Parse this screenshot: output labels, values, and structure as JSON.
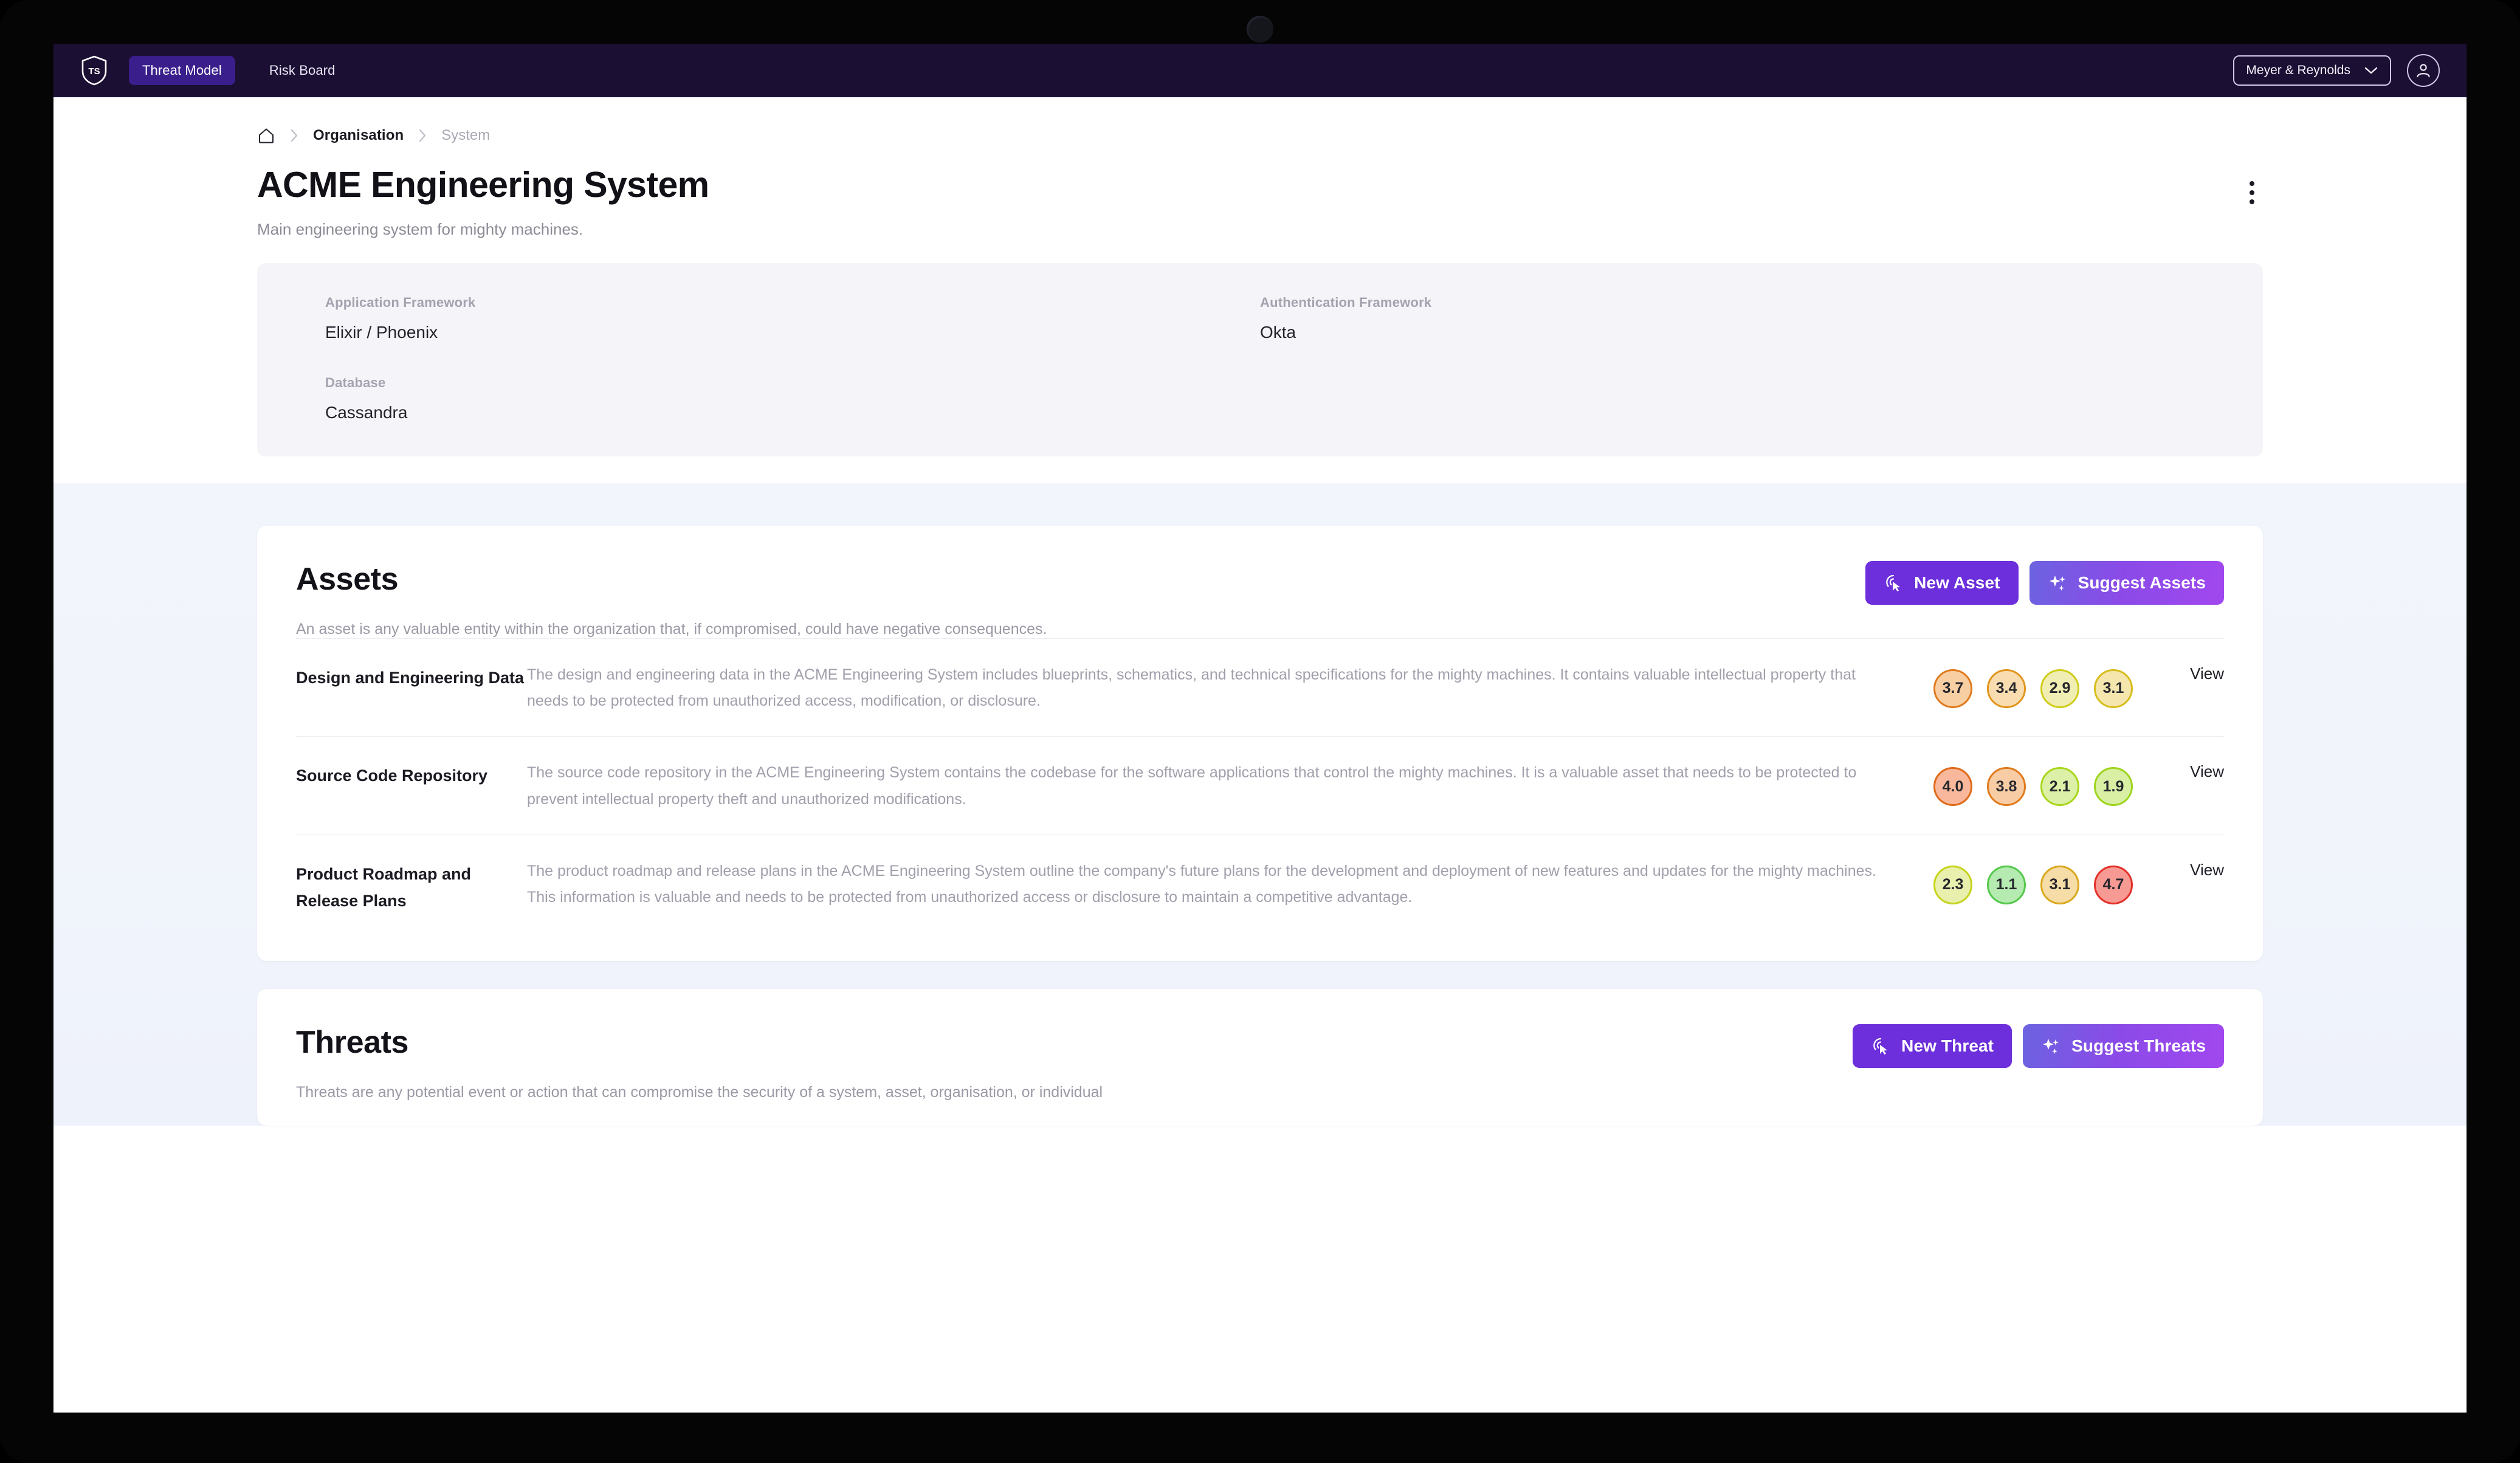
{
  "navbar": {
    "logo_text": "TS",
    "logo_icon": "shield-icon",
    "tabs": [
      {
        "label": "Threat Model",
        "active": true
      },
      {
        "label": "Risk Board",
        "active": false
      }
    ],
    "org_switcher": {
      "label": "Meyer & Reynolds",
      "icon": "chevron-down-icon"
    },
    "avatar_icon": "user-avatar-icon",
    "background_color": "#1b0f33",
    "active_tab_color": "#3a1f8c"
  },
  "breadcrumb": {
    "home_icon": "home-icon",
    "separator_icon": "chevron-right-icon",
    "items": [
      {
        "label": "Organisation",
        "current": false
      },
      {
        "label": "System",
        "current": true
      }
    ]
  },
  "header": {
    "title": "ACME Engineering System",
    "subtitle": "Main engineering system for mighty machines.",
    "kebab_icon": "more-vertical-icon"
  },
  "metadata": [
    {
      "label": "Application Framework",
      "value": "Elixir / Phoenix"
    },
    {
      "label": "Authentication Framework",
      "value": "Okta"
    },
    {
      "label": "Database",
      "value": "Cassandra"
    }
  ],
  "assets_section": {
    "title": "Assets",
    "description": "An asset is any valuable entity within the organization that, if compromised, could have negative consequences.",
    "new_button": {
      "label": "New Asset",
      "icon": "click-cursor-icon",
      "color": "#6c2fdb"
    },
    "suggest_button": {
      "label": "Suggest Assets",
      "icon": "sparkles-icon"
    },
    "view_label": "View",
    "rows": [
      {
        "name": "Design and Engineering Data",
        "description": "The design and engineering data in the ACME Engineering System includes blueprints, schematics, and technical specifications for the mighty machines. It contains valuable intellectual property that needs to be protected from unauthorized access, modification, or disclosure.",
        "scores": [
          {
            "value": "3.7",
            "border": "#e07a1e",
            "fill": "#f8cfa2"
          },
          {
            "value": "3.4",
            "border": "#e2951d",
            "fill": "#f9ddb0"
          },
          {
            "value": "2.9",
            "border": "#cfcc1c",
            "fill": "#f0eeb2"
          },
          {
            "value": "3.1",
            "border": "#d7bd1c",
            "fill": "#f5e6ad"
          }
        ],
        "view": "View"
      },
      {
        "name": "Source Code Repository",
        "description": "The source code repository in the ACME Engineering System contains the codebase for the software applications that control the mighty machines. It is a valuable asset that needs to be protected to prevent intellectual property theft and unauthorized modifications.",
        "scores": [
          {
            "value": "4.0",
            "border": "#df6a19",
            "fill": "#f9b79b"
          },
          {
            "value": "3.8",
            "border": "#e07a1e",
            "fill": "#f8cca4"
          },
          {
            "value": "2.1",
            "border": "#a8d61c",
            "fill": "#ddf0a8"
          },
          {
            "value": "1.9",
            "border": "#9ed41c",
            "fill": "#d8efa4"
          }
        ],
        "view": "View"
      },
      {
        "name": "Product Roadmap and Release Plans",
        "description": "The product roadmap and release plans in the ACME Engineering System outline the company's future plans for the development and deployment of new features and updates for the mighty machines. This information is valuable and needs to be protected from unauthorized access or disclosure to maintain a competitive advantage.",
        "scores": [
          {
            "value": "2.3",
            "border": "#c6d31c",
            "fill": "#e9f0ad"
          },
          {
            "value": "1.1",
            "border": "#55c94c",
            "fill": "#b5eab0"
          },
          {
            "value": "3.1",
            "border": "#d9a81d",
            "fill": "#f6dca6"
          },
          {
            "value": "4.7",
            "border": "#e33028",
            "fill": "#f79a94"
          }
        ],
        "view": "View"
      }
    ]
  },
  "threats_section": {
    "title": "Threats",
    "description": "Threats are any potential event or action that can compromise the security of a system, asset, organisation, or individual",
    "new_button": {
      "label": "New Threat",
      "icon": "click-cursor-icon"
    },
    "suggest_button": {
      "label": "Suggest Threats",
      "icon": "sparkles-icon"
    }
  }
}
